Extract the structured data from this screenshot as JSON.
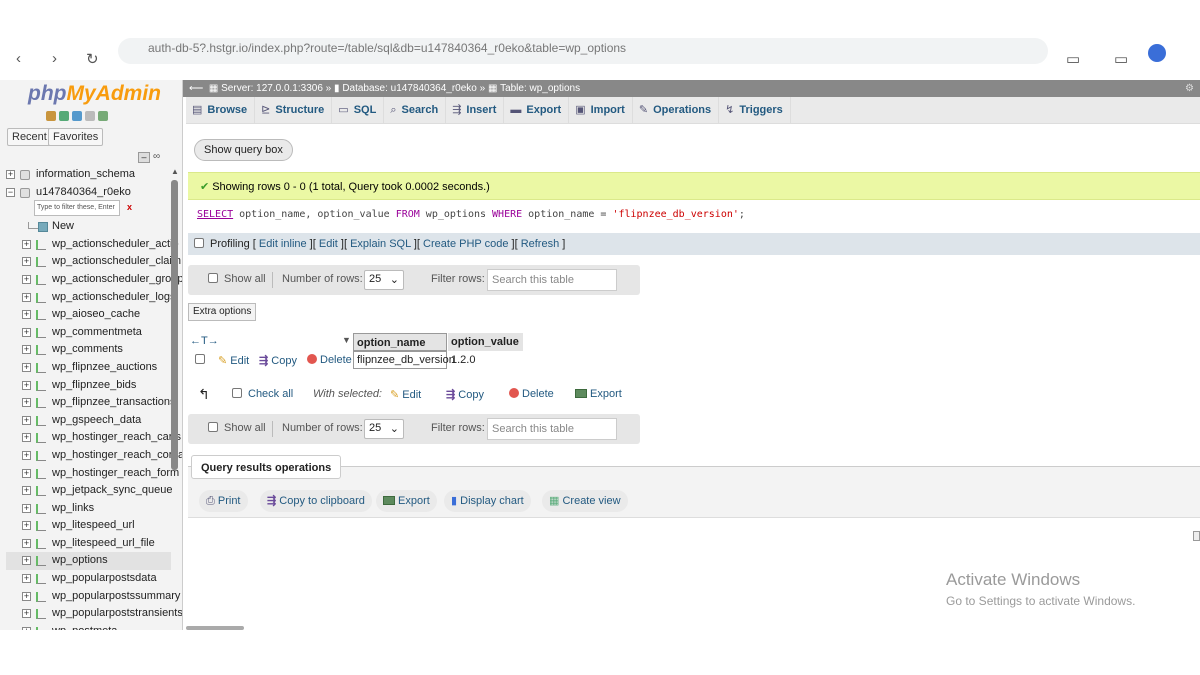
{
  "browser": {
    "url": "auth-db-5?.hstgr.io/index.php?route=/table/sql&db=u147840364_r0eko&table=wp_options"
  },
  "left_panel": {
    "logo_php": "php",
    "logo_myadmin": "MyAdmin",
    "tab_recent": "Recent",
    "tab_favorites": "Favorites",
    "filter_placeholder": "Type to filter these, Enter",
    "filter_clear": "x",
    "tree": [
      {
        "label": "information_schema",
        "type": "db"
      },
      {
        "label": "u147840364_r0eko",
        "type": "db"
      },
      {
        "label": "New",
        "type": "new"
      },
      {
        "label": "wp_actionscheduler_actio",
        "type": "table"
      },
      {
        "label": "wp_actionscheduler_claim",
        "type": "table"
      },
      {
        "label": "wp_actionscheduler_group",
        "type": "table"
      },
      {
        "label": "wp_actionscheduler_logs",
        "type": "table"
      },
      {
        "label": "wp_aioseo_cache",
        "type": "table"
      },
      {
        "label": "wp_commentmeta",
        "type": "table"
      },
      {
        "label": "wp_comments",
        "type": "table"
      },
      {
        "label": "wp_flipnzee_auctions",
        "type": "table"
      },
      {
        "label": "wp_flipnzee_bids",
        "type": "table"
      },
      {
        "label": "wp_flipnzee_transactions",
        "type": "table"
      },
      {
        "label": "wp_gspeech_data",
        "type": "table"
      },
      {
        "label": "wp_hostinger_reach_carts",
        "type": "table"
      },
      {
        "label": "wp_hostinger_reach_conta",
        "type": "table"
      },
      {
        "label": "wp_hostinger_reach_form",
        "type": "table"
      },
      {
        "label": "wp_jetpack_sync_queue",
        "type": "table"
      },
      {
        "label": "wp_links",
        "type": "table"
      },
      {
        "label": "wp_litespeed_url",
        "type": "table"
      },
      {
        "label": "wp_litespeed_url_file",
        "type": "table"
      },
      {
        "label": "wp_options",
        "type": "table",
        "selected": true
      },
      {
        "label": "wp_popularpostsdata",
        "type": "table"
      },
      {
        "label": "wp_popularpostssummary",
        "type": "table"
      },
      {
        "label": "wp_popularpoststransients",
        "type": "table"
      },
      {
        "label": "wp_postmeta",
        "type": "table"
      }
    ]
  },
  "breadcrumb": {
    "server": "Server: 127.0.0.1:3306",
    "database": "Database: u147840364_r0eko",
    "table": "Table: wp_options",
    "sep": "»"
  },
  "tabs": [
    {
      "label": "Browse",
      "icon": "browse-icon"
    },
    {
      "label": "Structure",
      "icon": "structure-icon"
    },
    {
      "label": "SQL",
      "icon": "sql-icon"
    },
    {
      "label": "Search",
      "icon": "search-icon"
    },
    {
      "label": "Insert",
      "icon": "insert-icon"
    },
    {
      "label": "Export",
      "icon": "export-icon"
    },
    {
      "label": "Import",
      "icon": "import-icon"
    },
    {
      "label": "Operations",
      "icon": "operations-icon"
    },
    {
      "label": "Triggers",
      "icon": "triggers-icon"
    }
  ],
  "query_box_button": "Show query box",
  "success_message": "Showing rows 0 - 0 (1 total, Query took 0.0002 seconds.)",
  "sql": {
    "select": "SELECT",
    "cols": " option_name, option_value ",
    "from": "FROM",
    "table": " wp_options ",
    "where": "WHERE",
    "cond": " option_name = ",
    "value": "'flipnzee_db_version'",
    "end": ";"
  },
  "profiling": {
    "label": "Profiling",
    "links": [
      "Edit inline",
      "Edit",
      "Explain SQL",
      "Create PHP code",
      "Refresh"
    ]
  },
  "nav": {
    "show_all": "Show all",
    "num_rows_label": "Number of rows:",
    "num_rows_value": "25",
    "filter_label": "Filter rows:",
    "filter_placeholder": "Search this table"
  },
  "extra_options": "Extra options",
  "results": {
    "sort_arrows": "←T→",
    "columns": [
      "option_name",
      "option_value"
    ],
    "rows": [
      {
        "option_name": "flipnzee_db_version",
        "option_value": "1.2.0"
      }
    ],
    "row_actions": {
      "edit": "Edit",
      "copy": "Copy",
      "delete": "Delete"
    }
  },
  "with_selected": {
    "check_all": "Check all",
    "label": "With selected:",
    "edit": "Edit",
    "copy": "Copy",
    "delete": "Delete",
    "export": "Export"
  },
  "query_results_ops": {
    "title": "Query results operations",
    "print": "Print",
    "copy": "Copy to clipboard",
    "export": "Export",
    "chart": "Display chart",
    "view": "Create view"
  },
  "watermark": {
    "line1": "Activate Windows",
    "line2": "Go to Settings to activate Windows."
  }
}
